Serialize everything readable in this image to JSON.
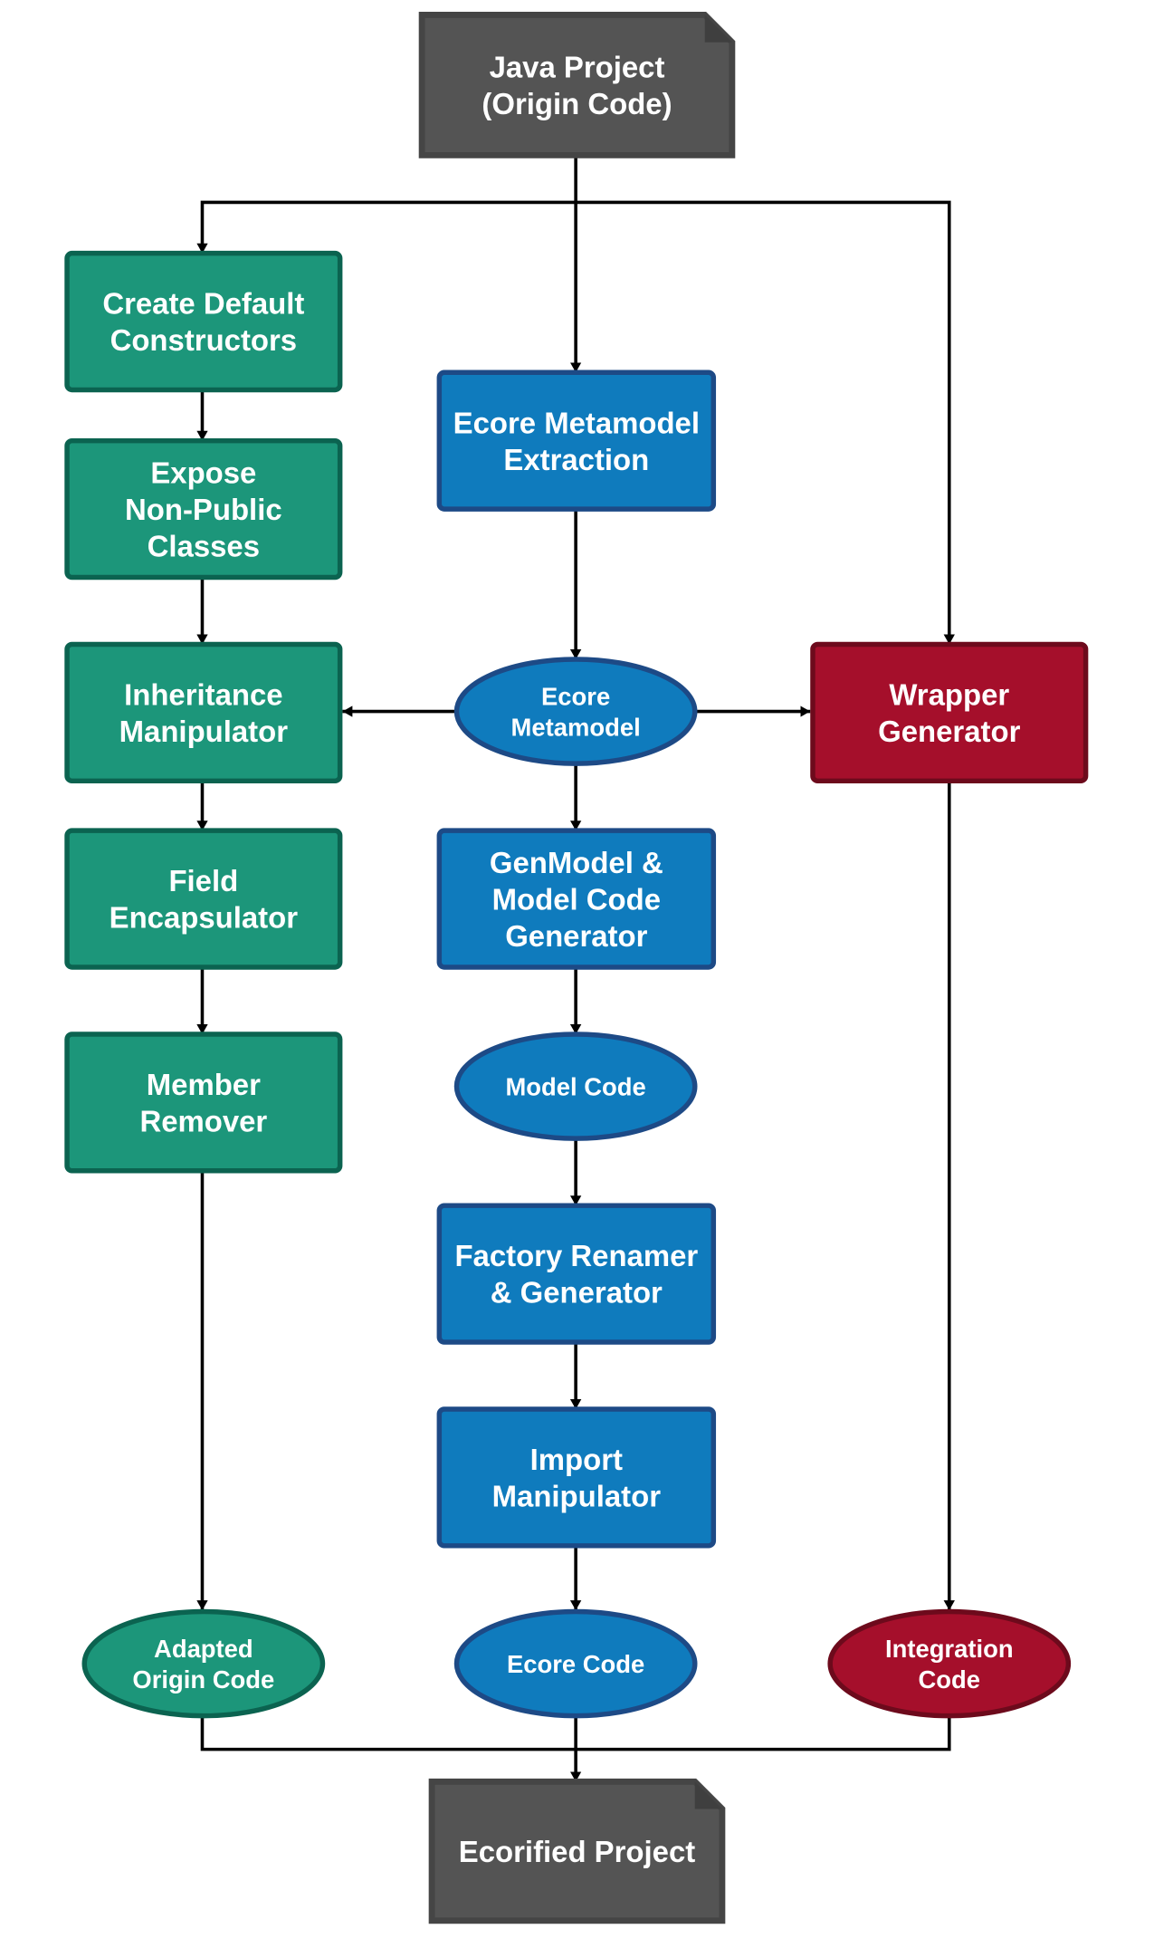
{
  "colors": {
    "green": "#1c967a",
    "green_border": "#0b6350",
    "blue": "#0f7bbd",
    "blue_border": "#1d4a86",
    "red": "#a50f2b",
    "red_border": "#6d0a1c",
    "gray": "#545454",
    "gray_border": "#454545"
  },
  "nodes": {
    "java_project": {
      "lines": [
        "Java Project",
        "(Origin Code)"
      ],
      "shape": "document",
      "color": "gray"
    },
    "create_default_constructors": {
      "lines": [
        "Create Default",
        "Constructors"
      ],
      "shape": "process",
      "color": "green"
    },
    "expose_non_public_classes": {
      "lines": [
        "Expose",
        "Non-Public",
        "Classes"
      ],
      "shape": "process",
      "color": "green"
    },
    "inheritance_manipulator": {
      "lines": [
        "Inheritance",
        "Manipulator"
      ],
      "shape": "process",
      "color": "green"
    },
    "field_encapsulator": {
      "lines": [
        "Field",
        "Encapsulator"
      ],
      "shape": "process",
      "color": "green"
    },
    "member_remover": {
      "lines": [
        "Member",
        "Remover"
      ],
      "shape": "process",
      "color": "green"
    },
    "ecore_metamodel_extraction": {
      "lines": [
        "Ecore Metamodel",
        "Extraction"
      ],
      "shape": "process",
      "color": "blue"
    },
    "ecore_metamodel": {
      "lines": [
        "Ecore",
        "Metamodel"
      ],
      "shape": "artifact",
      "color": "blue"
    },
    "genmodel_generator": {
      "lines": [
        "GenModel &",
        "Model Code",
        "Generator"
      ],
      "shape": "process",
      "color": "blue"
    },
    "model_code": {
      "lines": [
        "Model Code"
      ],
      "shape": "artifact",
      "color": "blue"
    },
    "factory_renamer": {
      "lines": [
        "Factory Renamer",
        "& Generator"
      ],
      "shape": "process",
      "color": "blue"
    },
    "import_manipulator": {
      "lines": [
        "Import",
        "Manipulator"
      ],
      "shape": "process",
      "color": "blue"
    },
    "wrapper_generator": {
      "lines": [
        "Wrapper",
        "Generator"
      ],
      "shape": "process",
      "color": "red"
    },
    "adapted_origin_code": {
      "lines": [
        "Adapted",
        "Origin Code"
      ],
      "shape": "artifact",
      "color": "green"
    },
    "ecore_code": {
      "lines": [
        "Ecore Code"
      ],
      "shape": "artifact",
      "color": "blue"
    },
    "integration_code": {
      "lines": [
        "Integration",
        "Code"
      ],
      "shape": "artifact",
      "color": "red"
    },
    "ecorified_project": {
      "lines": [
        "Ecorified Project"
      ],
      "shape": "document",
      "color": "gray"
    }
  }
}
